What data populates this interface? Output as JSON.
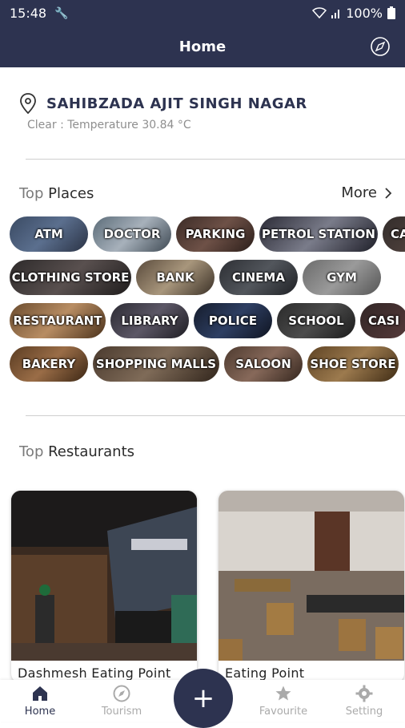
{
  "status": {
    "time": "15:48",
    "battery": "100%"
  },
  "appbar": {
    "title": "Home"
  },
  "location": {
    "city": "SAHIBZADA AJIT SINGH NAGAR",
    "weather": "Clear : Temperature 30.84 °C"
  },
  "top_places": {
    "title_prefix": "Top ",
    "title_main": "Places",
    "more_label": "More",
    "chips": [
      [
        "ATM",
        "DOCTOR",
        "PARKING",
        "PETROL STATION",
        "CA"
      ],
      [
        "CLOTHING STORE",
        "BANK",
        "CINEMA",
        "GYM"
      ],
      [
        "RESTAURANT",
        "LIBRARY",
        "POLICE",
        "SCHOOL",
        "CASI"
      ],
      [
        "BAKERY",
        "SHOPPING MALLS",
        "SALOON",
        "SHOE STORE"
      ]
    ]
  },
  "top_restaurants": {
    "title_prefix": "Top ",
    "title_main": "Restaurants",
    "cards": [
      {
        "name": "Dashmesh Eating Point"
      },
      {
        "name": "Eating Point"
      }
    ]
  },
  "nav": {
    "home": "Home",
    "tourism": "Tourism",
    "add": "+",
    "favourite": "Favourite",
    "setting": "Setting"
  }
}
